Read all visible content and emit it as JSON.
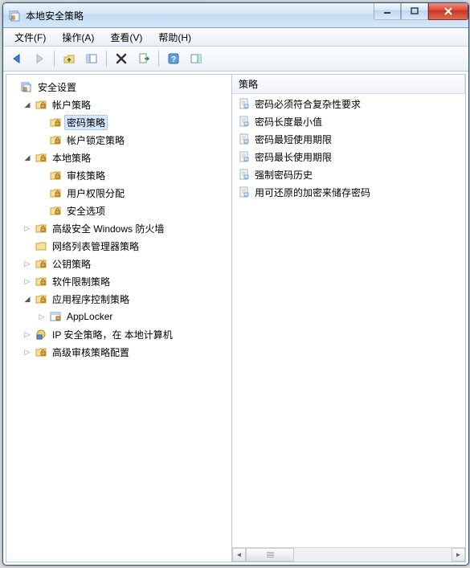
{
  "window": {
    "title": "本地安全策略"
  },
  "menu": {
    "file": "文件(F)",
    "action": "操作(A)",
    "view": "查看(V)",
    "help": "帮助(H)"
  },
  "toolbar": {
    "back": "back-icon",
    "forward": "forward-icon",
    "up": "up-icon",
    "show_hide": "show-hide-pane-icon",
    "delete": "delete-icon",
    "export": "export-list-icon",
    "help": "help-icon",
    "properties": "properties-icon"
  },
  "tree": {
    "root": {
      "label": "安全设置"
    },
    "nodes": [
      {
        "label": "帐户策略",
        "expanded": true,
        "children": [
          {
            "label": "密码策略",
            "selected": true
          },
          {
            "label": "帐户锁定策略"
          }
        ]
      },
      {
        "label": "本地策略",
        "expanded": true,
        "children": [
          {
            "label": "审核策略"
          },
          {
            "label": "用户权限分配"
          },
          {
            "label": "安全选项"
          }
        ]
      },
      {
        "label": "高级安全 Windows 防火墙",
        "expandable": true,
        "children": []
      },
      {
        "label": "网络列表管理器策略",
        "expandable": false
      },
      {
        "label": "公钥策略",
        "expandable": true,
        "children": []
      },
      {
        "label": "软件限制策略",
        "expandable": true,
        "children": []
      },
      {
        "label": "应用程序控制策略",
        "expanded": true,
        "children": [
          {
            "label": "AppLocker",
            "icon": "applocker",
            "expandable": true
          }
        ]
      },
      {
        "label": "IP 安全策略，在 本地计算机",
        "icon": "ipsec",
        "expandable": true,
        "children": []
      },
      {
        "label": "高级审核策略配置",
        "expandable": true,
        "children": []
      }
    ]
  },
  "list": {
    "header": {
      "policy": "策略"
    },
    "items": [
      "密码必须符合复杂性要求",
      "密码长度最小值",
      "密码最短使用期限",
      "密码最长使用期限",
      "强制密码历史",
      "用可还原的加密来储存密码"
    ]
  }
}
